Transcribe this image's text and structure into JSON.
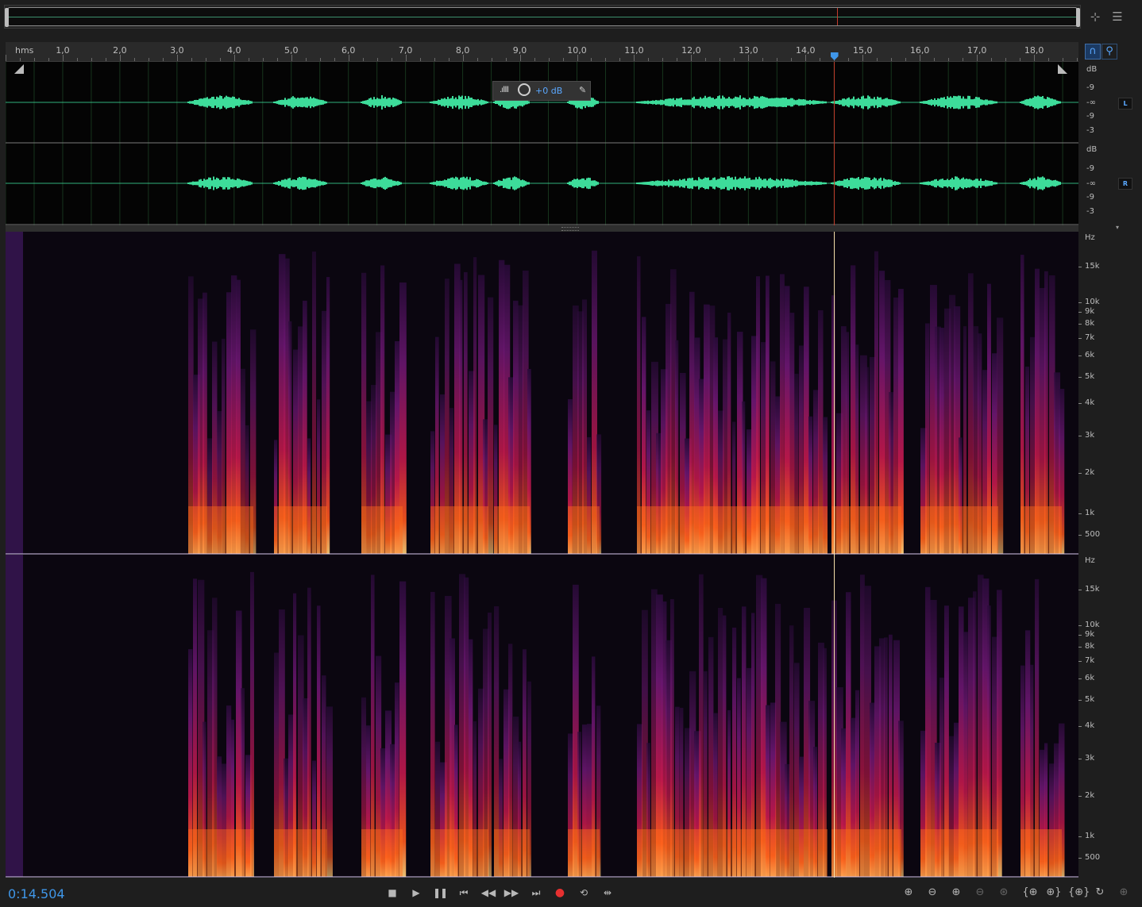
{
  "ruler": {
    "unit": "hms",
    "labels": [
      "1,0",
      "2,0",
      "3,0",
      "4,0",
      "5,0",
      "6,0",
      "7,0",
      "8,0",
      "9,0",
      "10,0",
      "11,0",
      "12,0",
      "13,0",
      "14,0",
      "15,0",
      "16,0",
      "17,0",
      "18,0"
    ]
  },
  "playhead_seconds": 14.504,
  "timecode": "0:14.504",
  "waveform": {
    "hud_gain": "+0 dB",
    "channel_left": "L",
    "channel_right": "R",
    "db_unit": "dB",
    "db_labels": [
      "-9",
      "-∞",
      "-9",
      "-3"
    ]
  },
  "spectral": {
    "unit": "Hz",
    "freq_labels": [
      "15k",
      "10k",
      "9k",
      "8k",
      "7k",
      "6k",
      "5k",
      "4k",
      "3k",
      "2k",
      "1k",
      "500"
    ]
  },
  "colors": {
    "waveform": "#3ddc9a",
    "playhead": "#c43c2c",
    "accent": "#3f96e8",
    "record": "#e63030"
  },
  "icons": {
    "top_right": [
      "target-icon",
      "list-icon"
    ],
    "transport": [
      "stop-icon",
      "play-icon",
      "pause-icon",
      "go-to-start-icon",
      "rewind-icon",
      "fast-forward-icon",
      "go-to-end-icon",
      "record-icon",
      "loop-icon",
      "skip-selection-icon"
    ],
    "zoom": [
      "zoom-in-amplitude-icon",
      "zoom-out-amplitude-icon",
      "zoom-in-time-icon",
      "zoom-out-time-icon",
      "zoom-out-full-icon",
      "zoom-in-point-icon",
      "zoom-out-point-icon",
      "zoom-selection-icon",
      "zoom-fit-icon",
      "zoom-reset-icon",
      "zoom-extra-icon"
    ]
  }
}
